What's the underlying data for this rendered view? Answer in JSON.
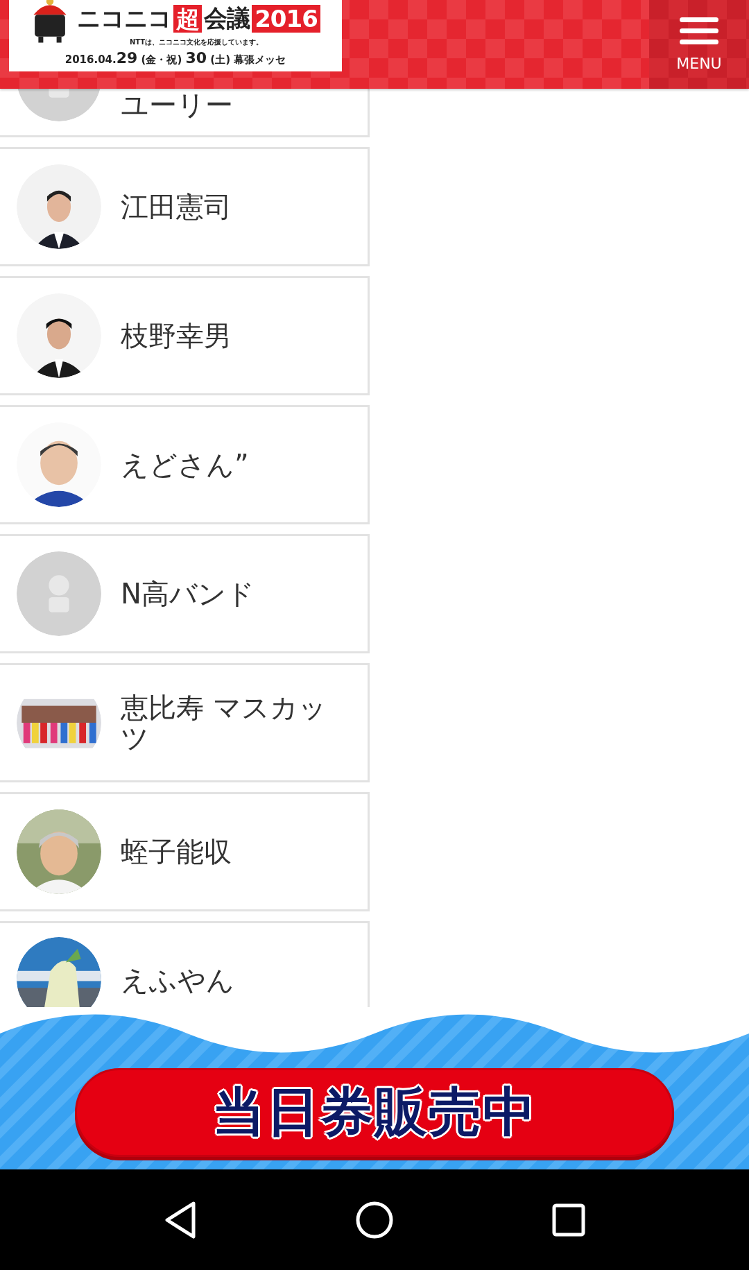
{
  "header": {
    "logo": {
      "parts": [
        {
          "text": "ニコニコ",
          "kind": "plain"
        },
        {
          "text": "超",
          "kind": "boxed"
        },
        {
          "text": "会議",
          "kind": "plain"
        },
        {
          "text": "2016",
          "kind": "boxed"
        }
      ],
      "tagline": "NTTは、ニコニコ文化を応援しています。",
      "date": "2016.04.**29** (金・祝) **30** (土) 幕張メッセ"
    },
    "menu_button": {
      "label": "MENU"
    }
  },
  "people": [
    {
      "name": "ユーリー",
      "kind": "no_image"
    },
    {
      "name": "江田憲司",
      "kind": "picture"
    },
    {
      "name": "枝野幸男",
      "kind": "picture"
    },
    {
      "name": "えどさん”",
      "kind": "picture"
    },
    {
      "name": "N高バンド",
      "kind": "no_image"
    },
    {
      "name": "恵比寿 マスカッツ",
      "kind": "picture"
    },
    {
      "name": "蛭子能収",
      "kind": "picture"
    },
    {
      "name": "えふやん",
      "kind": "picture"
    }
  ],
  "banner": {
    "button": "当日券販売中"
  },
  "nav_bar": [
    {
      "kind": "back"
    },
    {
      "kind": "home"
    },
    {
      "kind": "recents"
    }
  ]
}
